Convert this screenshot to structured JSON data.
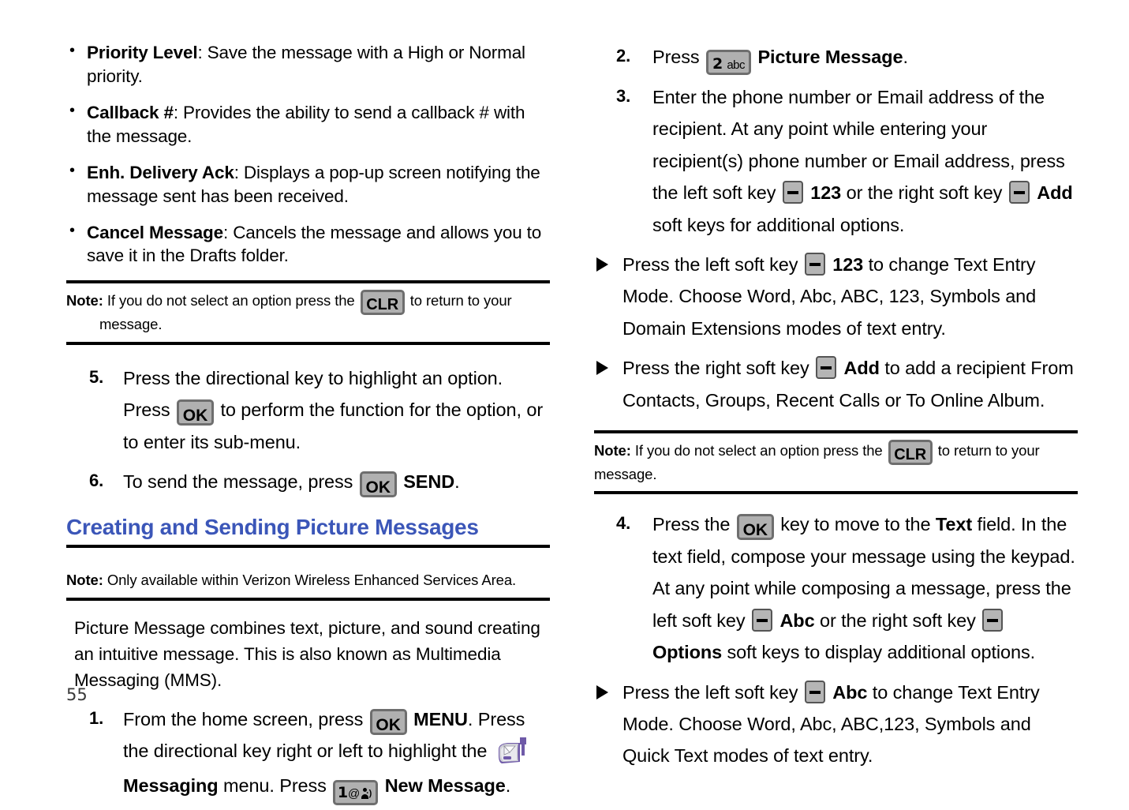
{
  "page": {
    "number": "55",
    "heading_color": "#3b56b8"
  },
  "left_column": {
    "option_bullets": [
      {
        "term": "Priority Level",
        "desc": ": Save the message with a High or Normal priority."
      },
      {
        "term": "Callback #",
        "desc": ": Provides the ability to send a callback # with the message."
      },
      {
        "term": "Enh. Delivery Ack",
        "desc": ": Displays a pop-up screen notifying the message sent has been received."
      },
      {
        "term": "Cancel Message",
        "desc": ": Cancels the message and allows you to save it in the Drafts folder."
      }
    ],
    "note_1": {
      "label": "Note:",
      "text_before_key": "If you do not select an option press the",
      "key": "CLR",
      "text_after_key": "to return to your",
      "text_line_2": "message."
    },
    "step_5": {
      "num": "5.",
      "part_1": "Press the directional key to highlight an option. Press",
      "key": "OK",
      "part_2": "to perform the function for the option, or to enter its sub-menu."
    },
    "step_6": {
      "num": "6.",
      "part_1": "To send the message, press",
      "key": "OK",
      "bold_label": "SEND",
      "part_2": "."
    },
    "heading": "Creating and Sending Picture Messages",
    "note_2": {
      "label": "Note:",
      "text": "Only available within Verizon Wireless Enhanced Services Area."
    },
    "intro_paragraph": "Picture Message combines text, picture, and sound creating an intuitive message. This is also known as Multimedia Messaging (MMS).",
    "step_1": {
      "num": "1.",
      "part_1": "From the home screen, press",
      "key_ok": "OK",
      "bold_menu": "MENU",
      "part_2": ". Press the directional key right or left to highlight the",
      "icon": "mailbox-icon",
      "bold_messaging": "Messaging",
      "part_3": "menu. Press",
      "key_1_digit": "1",
      "key_1_at": "@",
      "key_1_sms": "sms-icon",
      "bold_new_message": "New Message",
      "part_4": "."
    }
  },
  "right_column": {
    "step_2": {
      "num": "2.",
      "part_1": "Press",
      "key_digit": "2",
      "key_sub": "abc",
      "bold_label": "Picture Message",
      "part_2": "."
    },
    "step_3": {
      "num": "3.",
      "part_1": "Enter the phone number or Email address of the recipient. At any point while entering your recipient(s) phone number or Email address, press the left soft key",
      "softkey_1": "soft-key-icon",
      "bold_1": "123",
      "part_2": "or the right soft key",
      "softkey_2": "soft-key-icon",
      "bold_2": "Add",
      "part_3": "soft keys for additional options."
    },
    "tri_1": {
      "part_1": "Press the left soft key",
      "softkey": "soft-key-icon",
      "bold_1": "123",
      "part_2": "to change Text Entry Mode. Choose Word, Abc, ABC, 123, Symbols and Domain Extensions modes of text entry."
    },
    "tri_2": {
      "part_1": "Press the right soft key",
      "softkey": "soft-key-icon",
      "bold_1": "Add",
      "part_2": "to add a recipient From Contacts, Groups, Recent Calls or To Online Album."
    },
    "note_1": {
      "label": "Note:",
      "text_before_key": "If you do not select an option press the",
      "key": "CLR",
      "text_after_key": "to return to your message."
    },
    "step_4": {
      "num": "4.",
      "part_1": "Press the",
      "key_ok": "OK",
      "part_2": "key to move to the",
      "bold_text": "Text",
      "part_3": "field. In the text field, compose your message using the keypad. At any point while composing a message, press the left soft key",
      "softkey_1": "soft-key-icon",
      "bold_abc": "Abc",
      "part_4": "or the right soft key",
      "softkey_2": "soft-key-icon",
      "bold_options": "Options",
      "part_5": "soft keys to display additional options."
    },
    "tri_3": {
      "part_1": "Press the left soft key",
      "softkey": "soft-key-icon",
      "bold_1": "Abc",
      "part_2": "to change Text Entry Mode. Choose Word, Abc, ABC,123, Symbols and Quick Text modes of text entry."
    }
  }
}
